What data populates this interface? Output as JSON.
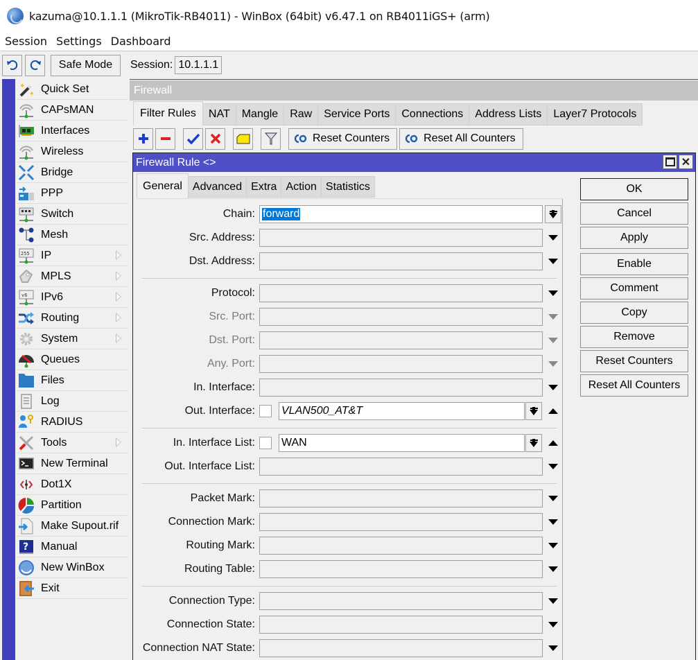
{
  "window": {
    "title": "kazuma@10.1.1.1 (MikroTik-RB4011) - WinBox (64bit) v6.47.1 on RB4011iGS+ (arm)",
    "icon": "winbox-logo-icon"
  },
  "menubar": {
    "items": [
      "Session",
      "Settings",
      "Dashboard"
    ]
  },
  "toolbar": {
    "undo_icon": "undo-icon",
    "redo_icon": "redo-icon",
    "safe_mode_label": "Safe Mode",
    "session_label": "Session:",
    "session_value": "10.1.1.1"
  },
  "sidebar": {
    "items": [
      {
        "label": "Quick Set",
        "icon": "wand-icon",
        "submenu": false
      },
      {
        "label": "CAPsMAN",
        "icon": "antenna-icon",
        "submenu": false
      },
      {
        "label": "Interfaces",
        "icon": "network-card-icon",
        "submenu": false
      },
      {
        "label": "Wireless",
        "icon": "wireless-icon",
        "submenu": false
      },
      {
        "label": "Bridge",
        "icon": "bridge-icon",
        "submenu": false
      },
      {
        "label": "PPP",
        "icon": "ppp-icon",
        "submenu": false
      },
      {
        "label": "Switch",
        "icon": "switch-icon",
        "submenu": false
      },
      {
        "label": "Mesh",
        "icon": "mesh-icon",
        "submenu": false
      },
      {
        "label": "IP",
        "icon": "ip-icon",
        "submenu": true
      },
      {
        "label": "MPLS",
        "icon": "mpls-icon",
        "submenu": true
      },
      {
        "label": "IPv6",
        "icon": "ipv6-icon",
        "submenu": true
      },
      {
        "label": "Routing",
        "icon": "routing-icon",
        "submenu": true
      },
      {
        "label": "System",
        "icon": "gear-icon",
        "submenu": true
      },
      {
        "label": "Queues",
        "icon": "gauge-icon",
        "submenu": false
      },
      {
        "label": "Files",
        "icon": "folder-icon",
        "submenu": false
      },
      {
        "label": "Log",
        "icon": "log-icon",
        "submenu": false
      },
      {
        "label": "RADIUS",
        "icon": "radius-icon",
        "submenu": false
      },
      {
        "label": "Tools",
        "icon": "tools-icon",
        "submenu": true
      },
      {
        "label": "New Terminal",
        "icon": "terminal-icon",
        "submenu": false
      },
      {
        "label": "Dot1X",
        "icon": "dot1x-icon",
        "submenu": false
      },
      {
        "label": "Partition",
        "icon": "partition-icon",
        "submenu": false
      },
      {
        "label": "Make Supout.rif",
        "icon": "supout-icon",
        "submenu": false
      },
      {
        "label": "Manual",
        "icon": "manual-icon",
        "submenu": false
      },
      {
        "label": "New WinBox",
        "icon": "winbox-icon",
        "submenu": false
      },
      {
        "label": "Exit",
        "icon": "exit-icon",
        "submenu": false
      }
    ]
  },
  "firewall": {
    "title": "Firewall",
    "tabs": [
      "Filter Rules",
      "NAT",
      "Mangle",
      "Raw",
      "Service Ports",
      "Connections",
      "Address Lists",
      "Layer7 Protocols"
    ],
    "active_tab": "Filter Rules",
    "toolbar": {
      "reset_counters": "Reset Counters",
      "reset_all_counters": "Reset All Counters"
    }
  },
  "dialog": {
    "title": "Firewall Rule <>",
    "tabs": [
      "General",
      "Advanced",
      "Extra",
      "Action",
      "Statistics"
    ],
    "active_tab": "General",
    "fields": {
      "chain": {
        "label": "Chain:",
        "value": "forward"
      },
      "src_address": {
        "label": "Src. Address:",
        "value": ""
      },
      "dst_address": {
        "label": "Dst. Address:",
        "value": ""
      },
      "protocol": {
        "label": "Protocol:",
        "value": ""
      },
      "src_port": {
        "label": "Src. Port:",
        "value": ""
      },
      "dst_port": {
        "label": "Dst. Port:",
        "value": ""
      },
      "any_port": {
        "label": "Any. Port:",
        "value": ""
      },
      "in_interface": {
        "label": "In. Interface:",
        "value": ""
      },
      "out_interface": {
        "label": "Out. Interface:",
        "value": "VLAN500_AT&T",
        "negate": false
      },
      "in_interface_list": {
        "label": "In. Interface List:",
        "value": "WAN",
        "negate": false
      },
      "out_interface_list": {
        "label": "Out. Interface List:",
        "value": ""
      },
      "packet_mark": {
        "label": "Packet Mark:",
        "value": ""
      },
      "connection_mark": {
        "label": "Connection Mark:",
        "value": ""
      },
      "routing_mark": {
        "label": "Routing Mark:",
        "value": ""
      },
      "routing_table": {
        "label": "Routing Table:",
        "value": ""
      },
      "connection_type": {
        "label": "Connection Type:",
        "value": ""
      },
      "connection_state": {
        "label": "Connection State:",
        "value": ""
      },
      "connection_nat_state": {
        "label": "Connection NAT State:",
        "value": ""
      }
    },
    "buttons": {
      "ok": "OK",
      "cancel": "Cancel",
      "apply": "Apply",
      "enable": "Enable",
      "comment": "Comment",
      "copy": "Copy",
      "remove": "Remove",
      "reset_counters": "Reset Counters",
      "reset_all_counters": "Reset All Counters"
    }
  },
  "colors": {
    "sidebar_strip": "#3f3fbf",
    "dialog_title_bg": "#4f4fc8",
    "selection": "#0078d7",
    "firewall_title_bg": "#c3c3c3"
  }
}
